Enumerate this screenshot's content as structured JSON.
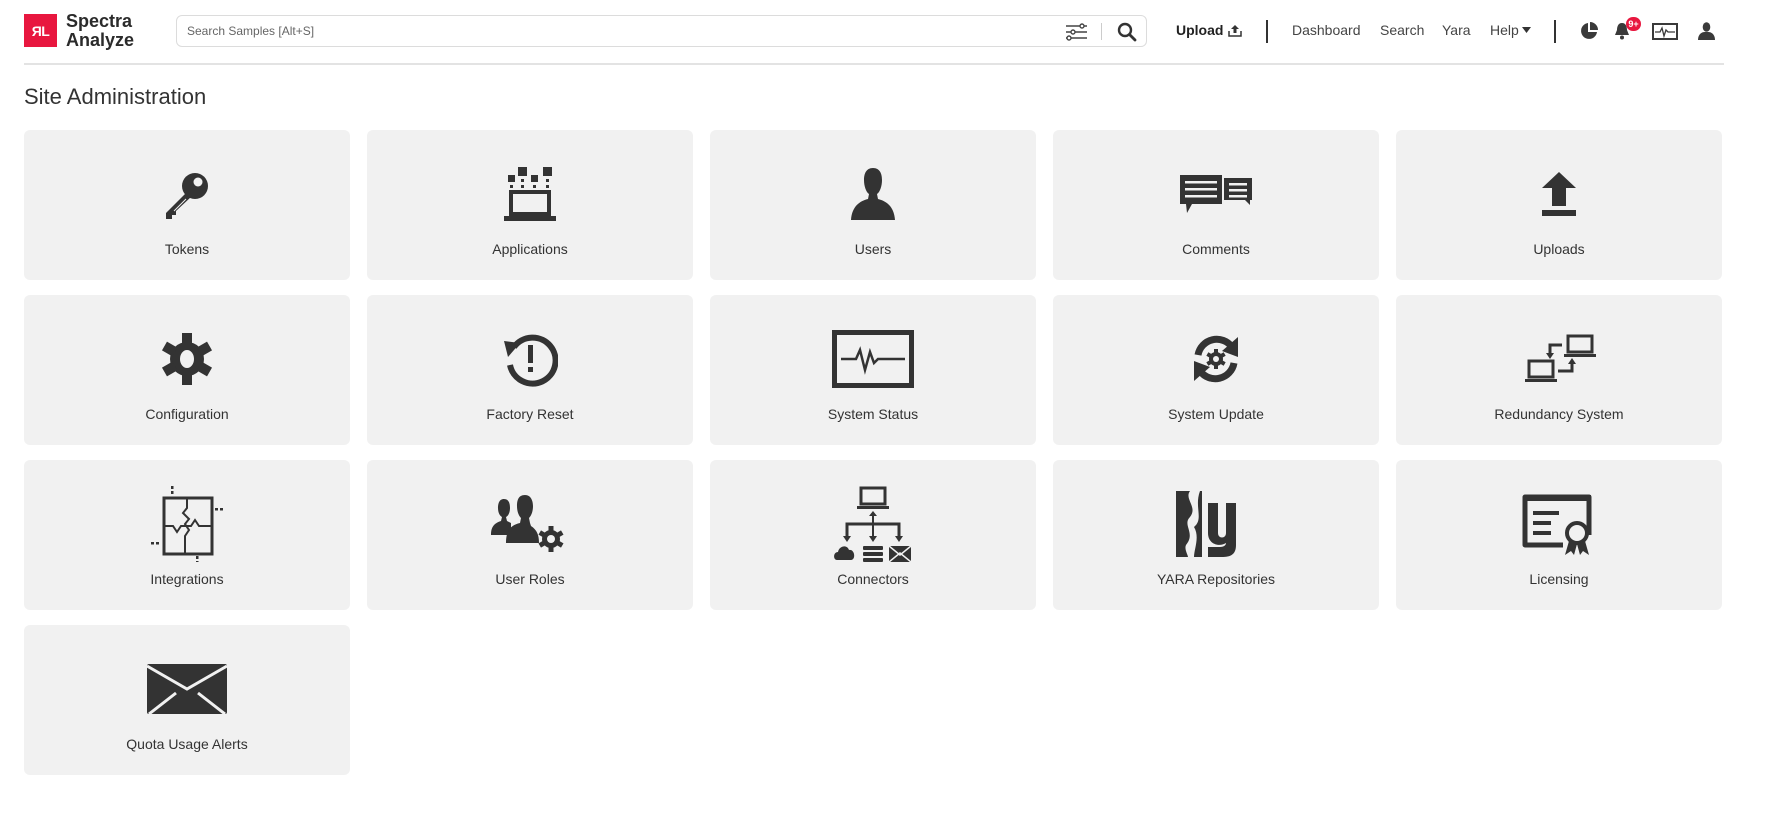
{
  "header": {
    "logo_text": "ЯL",
    "brand_line1": "Spectra",
    "brand_line2": "Analyze",
    "search_placeholder": "Search Samples [Alt+S]",
    "search_value": "",
    "upload_label": "Upload",
    "nav": [
      "Dashboard",
      "Search",
      "Yara",
      "Help"
    ],
    "notification_badge": "9+",
    "accent_color": "#e8173f"
  },
  "page": {
    "title": "Site Administration"
  },
  "tiles": [
    {
      "label": "Tokens",
      "icon": "key-icon"
    },
    {
      "label": "Applications",
      "icon": "applications-icon"
    },
    {
      "label": "Users",
      "icon": "user-icon"
    },
    {
      "label": "Comments",
      "icon": "comments-icon"
    },
    {
      "label": "Uploads",
      "icon": "upload-icon"
    },
    {
      "label": "Configuration",
      "icon": "gear-icon"
    },
    {
      "label": "Factory Reset",
      "icon": "factory-reset-icon"
    },
    {
      "label": "System Status",
      "icon": "system-status-icon"
    },
    {
      "label": "System Update",
      "icon": "system-update-icon"
    },
    {
      "label": "Redundancy System",
      "icon": "redundancy-icon"
    },
    {
      "label": "Integrations",
      "icon": "integrations-icon"
    },
    {
      "label": "User Roles",
      "icon": "user-roles-icon"
    },
    {
      "label": "Connectors",
      "icon": "connectors-icon"
    },
    {
      "label": "YARA Repositories",
      "icon": "yara-icon"
    },
    {
      "label": "Licensing",
      "icon": "licensing-icon"
    },
    {
      "label": "Quota Usage Alerts",
      "icon": "envelope-icon"
    }
  ]
}
